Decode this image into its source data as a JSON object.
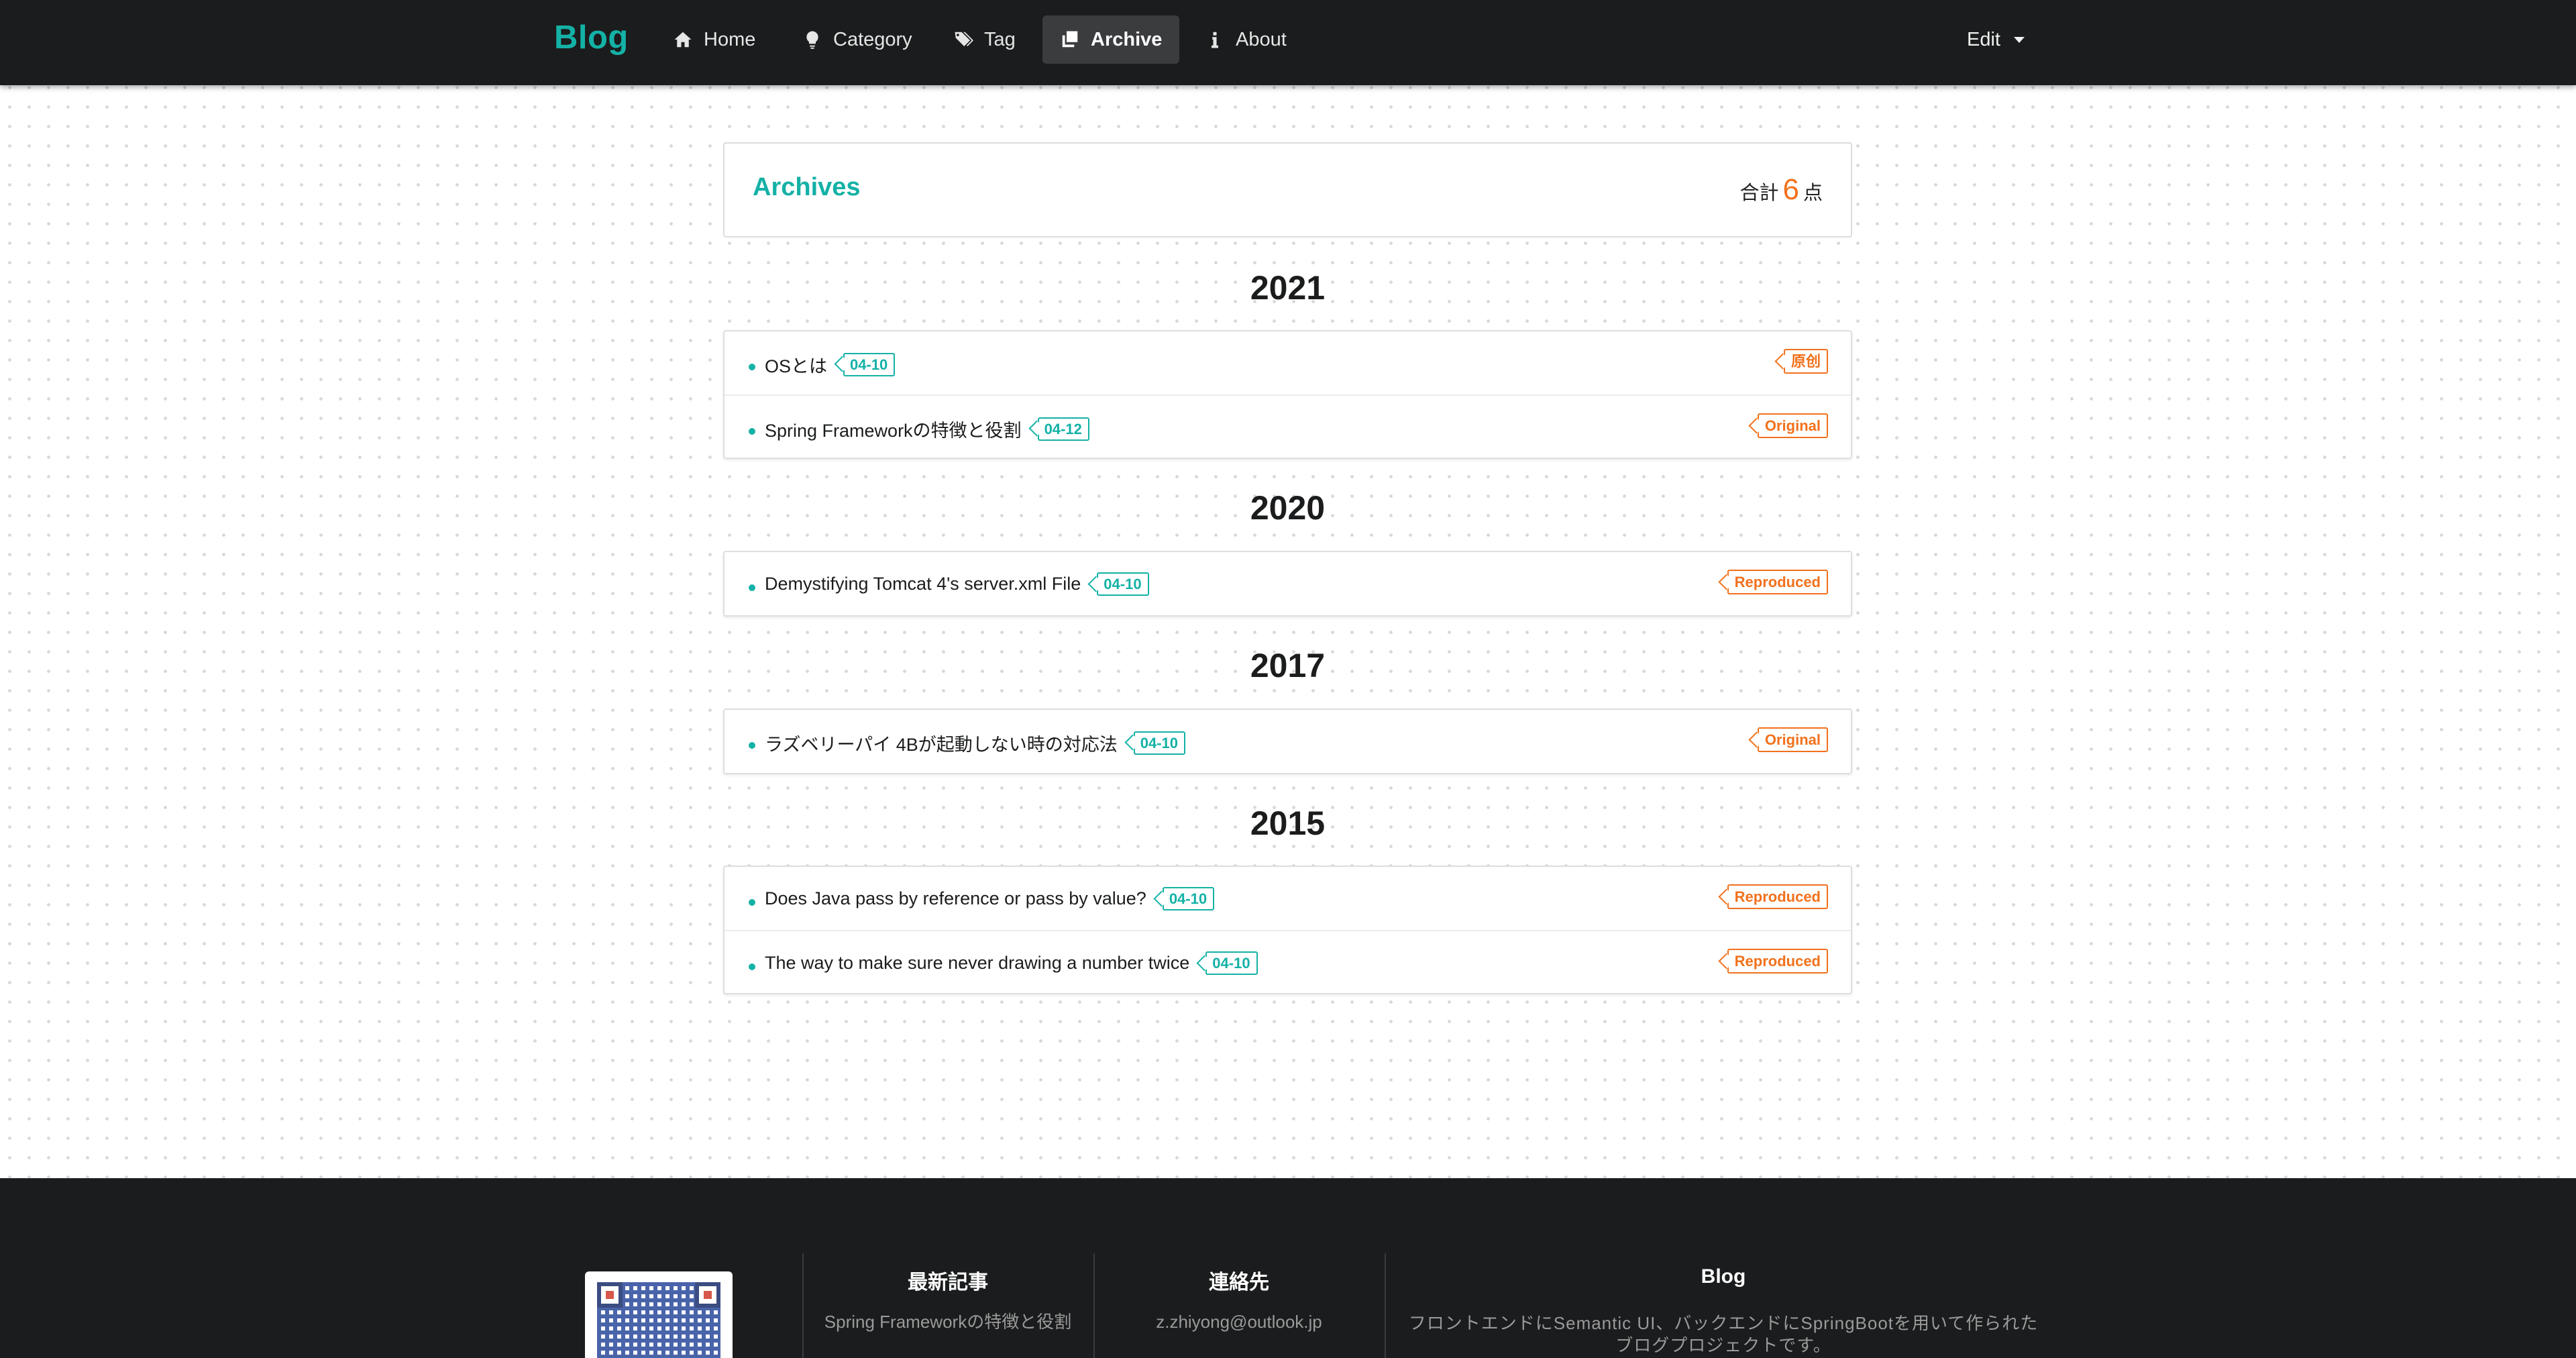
{
  "nav": {
    "brand": "Blog",
    "items": [
      {
        "label": "Home",
        "icon": "home-icon",
        "active": false
      },
      {
        "label": "Category",
        "icon": "lightbulb-icon",
        "active": false
      },
      {
        "label": "Tag",
        "icon": "tags-icon",
        "active": false
      },
      {
        "label": "Archive",
        "icon": "clone-icon",
        "active": true
      },
      {
        "label": "About",
        "icon": "info-icon",
        "active": false
      }
    ],
    "edit_label": "Edit"
  },
  "archives": {
    "title": "Archives",
    "count_prefix": "合計",
    "count": "6",
    "count_suffix": "点"
  },
  "years": [
    {
      "year": "2021",
      "posts": [
        {
          "title": "OSとは",
          "date": "04-10",
          "type": "原创"
        },
        {
          "title": "Spring Frameworkの特徴と役割",
          "date": "04-12",
          "type": "Original"
        }
      ]
    },
    {
      "year": "2020",
      "posts": [
        {
          "title": "Demystifying Tomcat 4's server.xml File",
          "date": "04-10",
          "type": "Reproduced"
        }
      ]
    },
    {
      "year": "2017",
      "posts": [
        {
          "title": "ラズベリーパイ 4Bが起動しない時の対応法",
          "date": "04-10",
          "type": "Original"
        }
      ]
    },
    {
      "year": "2015",
      "posts": [
        {
          "title": "Does Java pass by reference or pass by value?",
          "date": "04-10",
          "type": "Reproduced"
        },
        {
          "title": "The way to make sure never drawing a number twice",
          "date": "04-10",
          "type": "Reproduced"
        }
      ]
    }
  ],
  "footer": {
    "latest_title": "最新記事",
    "latest_text": "Spring Frameworkの特徴と役割",
    "contact_title": "連絡先",
    "contact_text": "z.zhiyong@outlook.jp",
    "blog_title": "Blog",
    "blog_text": "フロントエンドにSemantic UI、バックエンドにSpringBootを用いて作られたブログプロジェクトです。"
  },
  "colors": {
    "accent": "#14b1a6",
    "orange": "#f2711c",
    "nav_bg": "#1b1c1d"
  }
}
